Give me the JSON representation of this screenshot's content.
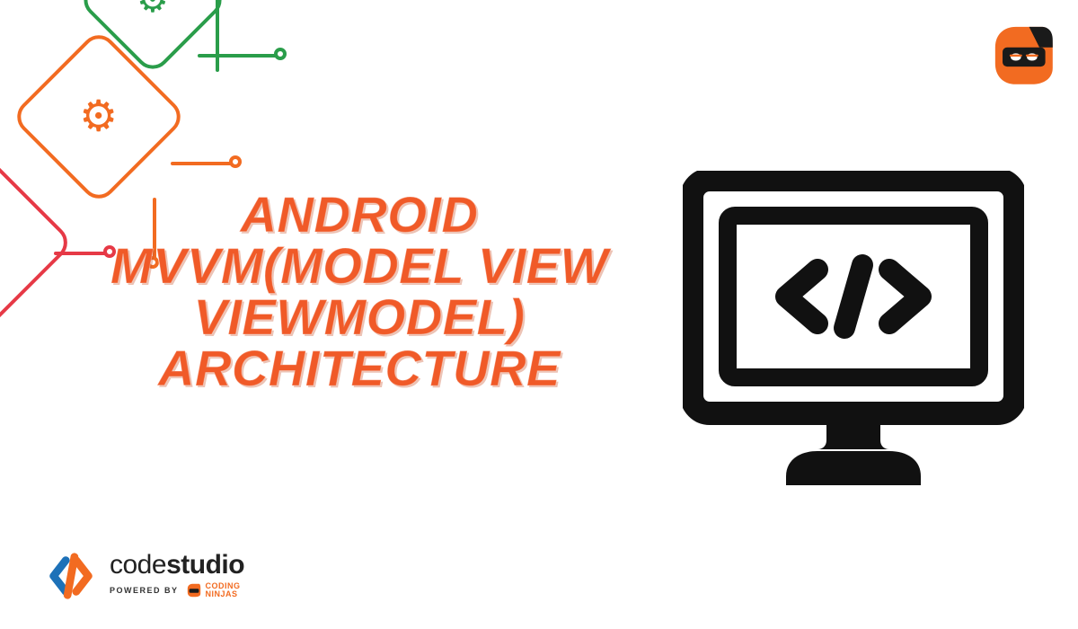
{
  "title": "ANDROID MVVM(MODEL VIEW VIEWMODEL) ARCHITECTURE",
  "logo": {
    "brand_light": "code",
    "brand_bold": "studio",
    "powered_label": "POWERED BY",
    "sponsor_line1": "CODING",
    "sponsor_line2": "NINJAS"
  },
  "icons": {
    "code_glyph": "</>",
    "monitor": "monitor-code-icon",
    "ninja": "coding-ninjas-mascot",
    "circuit": "circuit-chip-decoration"
  },
  "colors": {
    "accent": "#f05a28",
    "green": "#2a9d4a",
    "red": "#e63946",
    "blue": "#1d71b8",
    "black": "#111111"
  }
}
